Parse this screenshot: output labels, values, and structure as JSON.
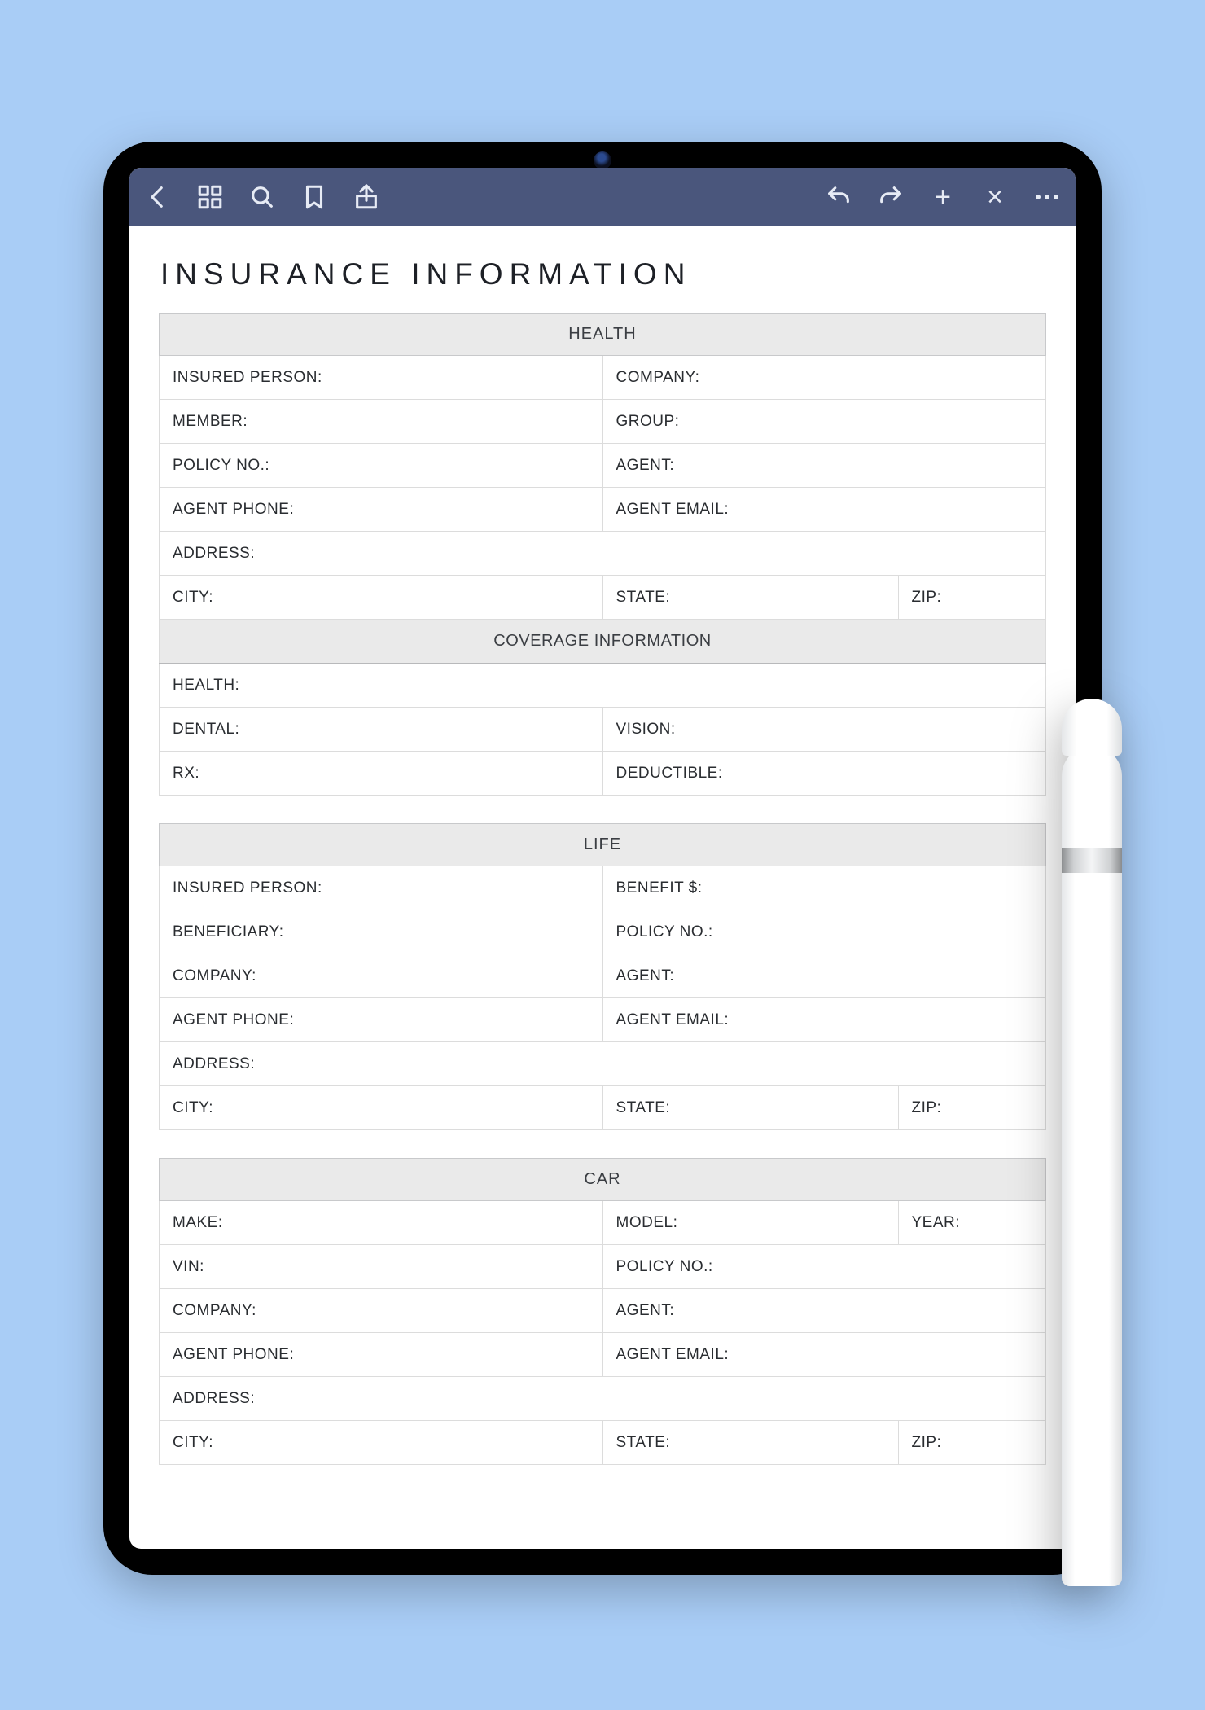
{
  "title": "INSURANCE INFORMATION",
  "toolbar": {
    "icons_left": [
      "back",
      "grid",
      "search",
      "bookmark",
      "share"
    ],
    "icons_right": [
      "undo",
      "redo",
      "plus",
      "close",
      "more"
    ]
  },
  "sections": {
    "health": {
      "header": "HEALTH",
      "rows": [
        [
          "INSURED PERSON:",
          "COMPANY:"
        ],
        [
          "MEMBER:",
          "GROUP:"
        ],
        [
          "POLICY NO.:",
          "AGENT:"
        ],
        [
          "AGENT PHONE:",
          "AGENT EMAIL:"
        ],
        [
          "ADDRESS:"
        ],
        [
          "CITY:",
          "STATE:",
          "ZIP:"
        ]
      ],
      "subheader": "COVERAGE INFORMATION",
      "rows2": [
        [
          "HEALTH:"
        ],
        [
          "DENTAL:",
          "VISION:"
        ],
        [
          "RX:",
          "DEDUCTIBLE:"
        ]
      ]
    },
    "life": {
      "header": "LIFE",
      "rows": [
        [
          "INSURED PERSON:",
          "BENEFIT $:"
        ],
        [
          "BENEFICIARY:",
          "POLICY NO.:"
        ],
        [
          "COMPANY:",
          "AGENT:"
        ],
        [
          "AGENT PHONE:",
          "AGENT EMAIL:"
        ],
        [
          "ADDRESS:"
        ],
        [
          "CITY:",
          "STATE:",
          "ZIP:"
        ]
      ]
    },
    "car": {
      "header": "CAR",
      "rows": [
        [
          "MAKE:",
          "MODEL:",
          "YEAR:"
        ],
        [
          "VIN:",
          "POLICY NO.:"
        ],
        [
          "COMPANY:",
          "AGENT:"
        ],
        [
          "AGENT PHONE:",
          "AGENT EMAIL:"
        ],
        [
          "ADDRESS:"
        ],
        [
          "CITY:",
          "STATE:",
          "ZIP:"
        ]
      ]
    }
  }
}
